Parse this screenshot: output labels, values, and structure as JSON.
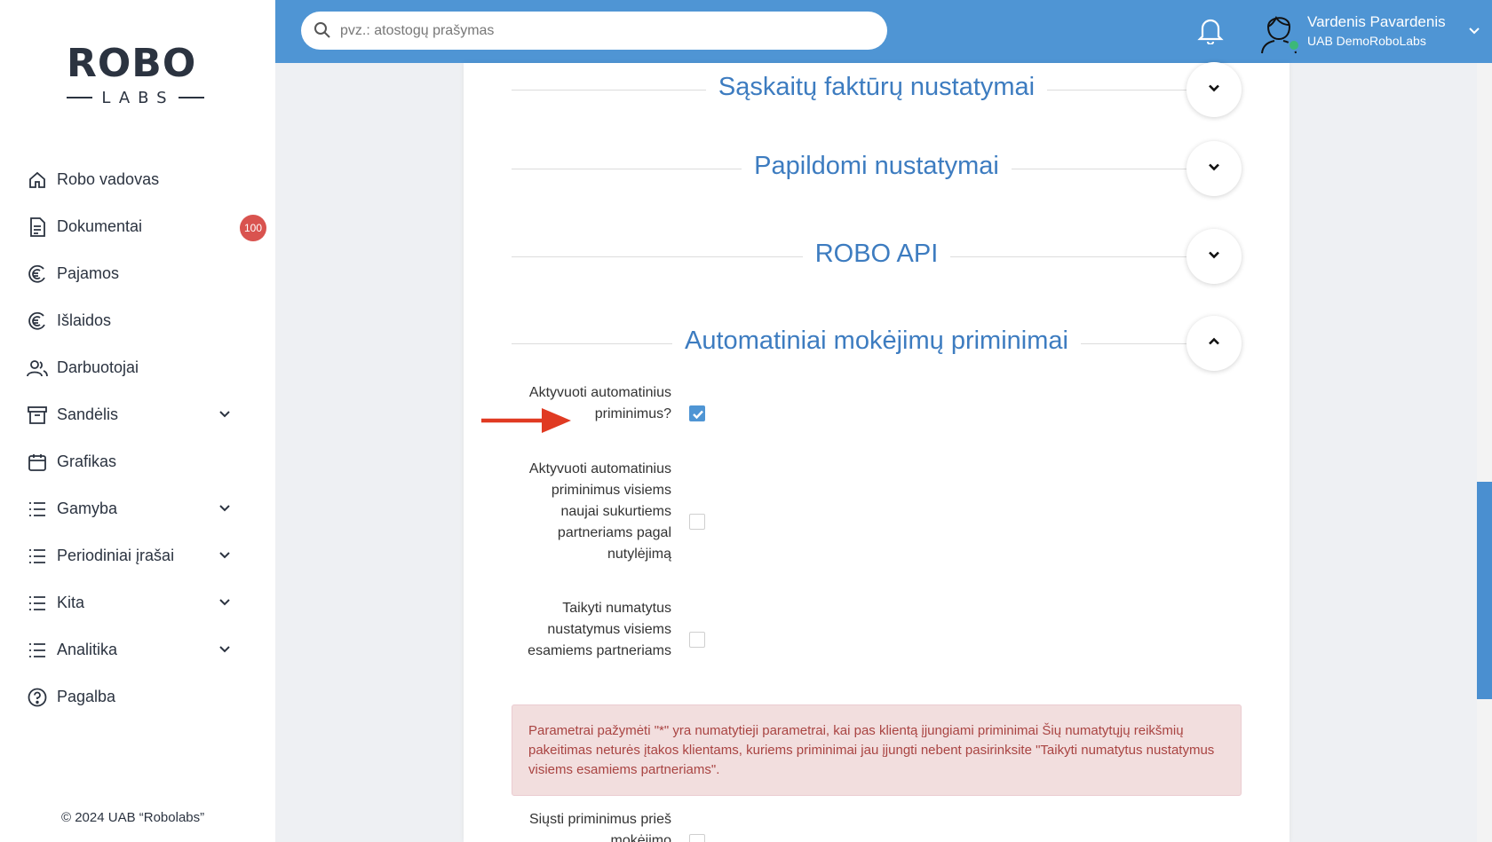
{
  "sidebar": {
    "logo_text": "ROBO",
    "logo_subtext": "LABS",
    "items": [
      {
        "label": "Robo vadovas",
        "icon": "home-icon"
      },
      {
        "label": "Dokumentai",
        "icon": "document-icon",
        "badge": "100"
      },
      {
        "label": "Pajamos",
        "icon": "euro-coin-icon"
      },
      {
        "label": "Išlaidos",
        "icon": "euro-coin-icon"
      },
      {
        "label": "Darbuotojai",
        "icon": "users-icon"
      },
      {
        "label": "Sandėlis",
        "icon": "archive-icon",
        "expandable": true
      },
      {
        "label": "Grafikas",
        "icon": "calendar-icon"
      },
      {
        "label": "Gamyba",
        "icon": "list-icon",
        "expandable": true
      },
      {
        "label": "Periodiniai įrašai",
        "icon": "list-icon",
        "expandable": true
      },
      {
        "label": "Kita",
        "icon": "list-icon",
        "expandable": true
      },
      {
        "label": "Analitika",
        "icon": "list-icon",
        "expandable": true
      },
      {
        "label": "Pagalba",
        "icon": "help-circle-icon"
      }
    ],
    "copyright": "© 2024 UAB “Robolabs”"
  },
  "topbar": {
    "search_placeholder": "pvz.: atostogų prašymas",
    "search_value": "",
    "user_name": "Vardenis Pavardenis",
    "user_company": "UAB DemoRoboLabs",
    "user_status": "online"
  },
  "sections": [
    {
      "title": "Sąskaitų faktūrų nustatymai",
      "expanded": false
    },
    {
      "title": "Papildomi nustatymai",
      "expanded": false
    },
    {
      "title": "ROBO API",
      "expanded": false
    },
    {
      "title": "Automatiniai mokėjimų priminimai",
      "expanded": true
    }
  ],
  "reminder_fields": [
    {
      "label": "Aktyvuoti automatinius priminimus?",
      "checked": true
    },
    {
      "label": "Aktyvuoti automatinius priminimus visiems naujai sukurtiems partneriams pagal nutylėjimą",
      "checked": false
    },
    {
      "label": "Taikyti numatytus nustatymus visiems esamiems partneriams",
      "checked": false
    },
    {
      "label": "Siųsti priminimus prieš mokėjimo",
      "checked": false
    }
  ],
  "alert_text": "Parametrai pažymėti \"*\" yra numatytieji parametrai, kai pas klientą įjungiami priminimai Šių numatytųjų reikšmių pakeitimas neturės įtakos klientams, kuriems priminimai jau įjungti nebent pasirinksite \"Taikyti numatytus nustatymus visiems esamiems partneriams\".",
  "colors": {
    "topbar": "#4f95d4",
    "section_title": "#3d7cc0",
    "badge": "#d9534f",
    "alert_bg": "#f2dede",
    "alert_text": "#a94442",
    "annotation_arrow": "#e03a22"
  }
}
